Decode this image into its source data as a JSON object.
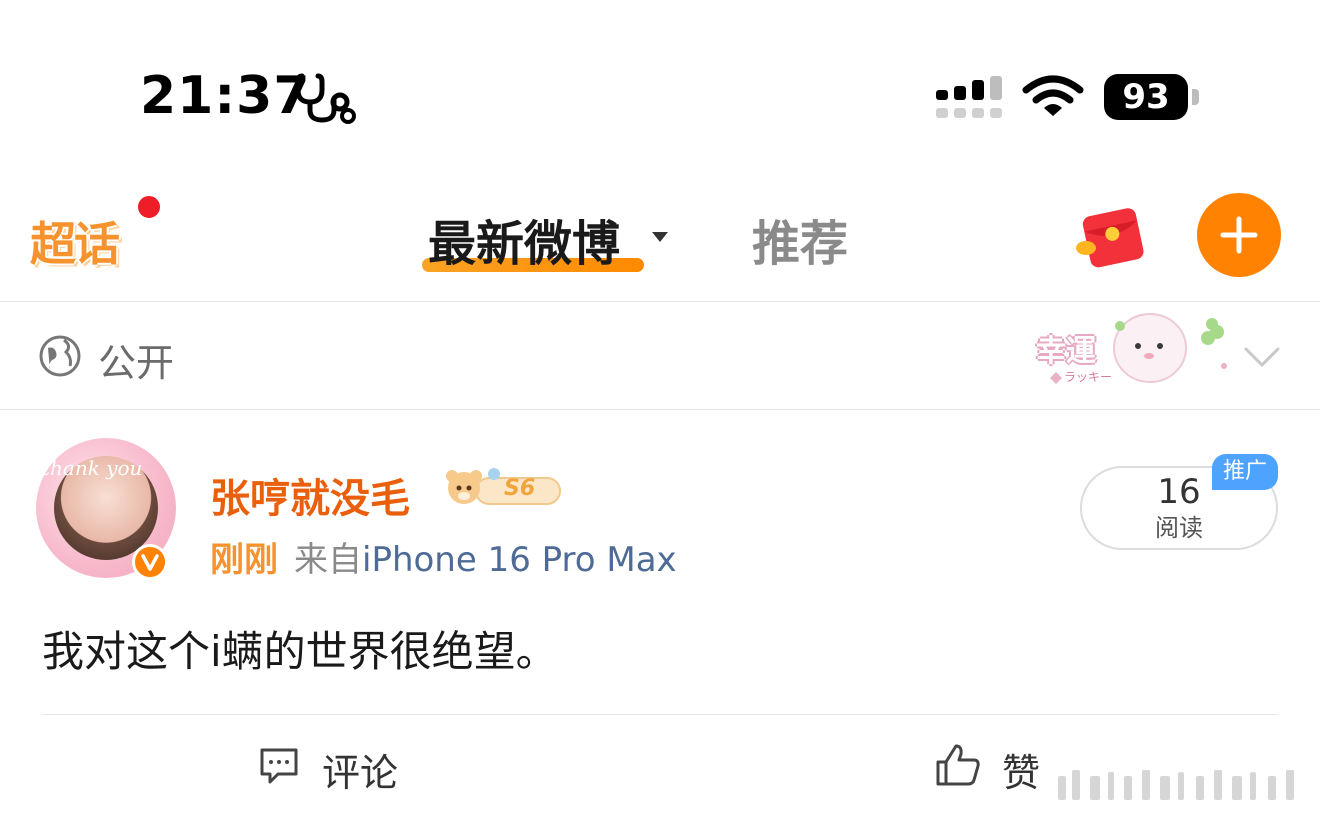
{
  "status_bar": {
    "time": "21:37",
    "battery": "93"
  },
  "header": {
    "logo_text": "超话",
    "tabs": [
      {
        "label": "最新微博"
      },
      {
        "label": "推荐"
      }
    ]
  },
  "privacy": {
    "label": "公开"
  },
  "sticker": {
    "text": "幸運",
    "subtext": "ラッキー"
  },
  "post": {
    "avatar_text": "thank you",
    "username": "张哼就没毛",
    "level": "S6",
    "time": "刚刚",
    "from_prefix": "来自",
    "device": "iPhone 16 Pro Max",
    "reads_count": "16",
    "reads_label": "阅读",
    "promo_tag": "推广",
    "content": "我对这个i螨的世界很绝望。"
  },
  "actions": {
    "comment_label": "评论",
    "like_label": "赞"
  },
  "colors": {
    "accent": "#ff8200",
    "username": "#ea5f0c",
    "device_link": "#4e6a96",
    "promo": "#4da3ff"
  }
}
